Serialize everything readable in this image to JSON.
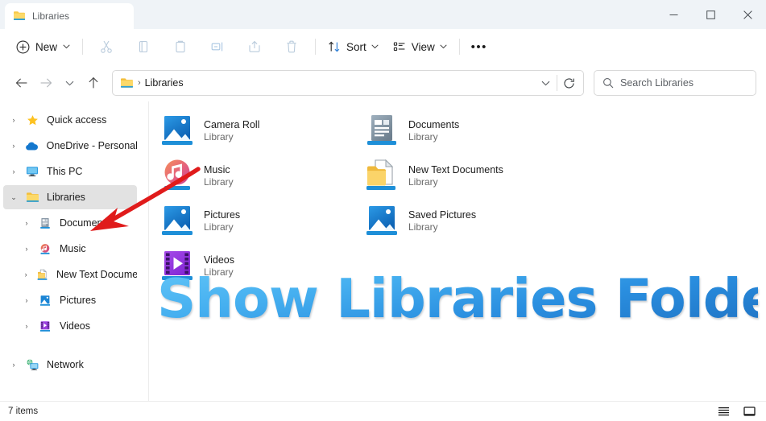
{
  "window": {
    "tab_title": "Libraries",
    "controls": {
      "minimize": "—",
      "maximize": "□",
      "close": "✕"
    }
  },
  "toolbar": {
    "new_label": "New",
    "sort_label": "Sort",
    "view_label": "View",
    "overflow_label": "•••",
    "chevron": "⌄",
    "icons": [
      {
        "name": "cut-icon",
        "title": "Cut"
      },
      {
        "name": "copy-icon",
        "title": "Copy"
      },
      {
        "name": "paste-icon",
        "title": "Paste"
      },
      {
        "name": "rename-icon",
        "title": "Rename"
      },
      {
        "name": "share-icon",
        "title": "Share"
      },
      {
        "name": "delete-icon",
        "title": "Delete"
      }
    ]
  },
  "address": {
    "back": "←",
    "forward": "→",
    "recent_chevron": "⌄",
    "up": "↑",
    "path_text": "Libraries",
    "path_separator": "›",
    "dropdown_chevron": "⌄",
    "refresh": "⟳"
  },
  "search": {
    "placeholder": "Search Libraries",
    "icon": "search-icon"
  },
  "sidebar": {
    "items": [
      {
        "label": "Quick access",
        "icon": "star-icon",
        "twisty": "›",
        "level": 0,
        "selected": false
      },
      {
        "label": "OneDrive - Personal",
        "icon": "cloud-icon",
        "twisty": "›",
        "level": 0,
        "selected": false
      },
      {
        "label": "This PC",
        "icon": "monitor-icon",
        "twisty": "›",
        "level": 0,
        "selected": false
      },
      {
        "label": "Libraries",
        "icon": "folder-icon",
        "twisty": "⌄",
        "level": 0,
        "selected": true
      },
      {
        "label": "Documents",
        "icon": "documents-library-icon",
        "twisty": "›",
        "level": 1,
        "selected": false
      },
      {
        "label": "Music",
        "icon": "music-library-icon",
        "twisty": "›",
        "level": 1,
        "selected": false
      },
      {
        "label": "New Text Document",
        "icon": "folder-doc-icon",
        "twisty": "›",
        "level": 1,
        "selected": false
      },
      {
        "label": "Pictures",
        "icon": "pictures-library-icon",
        "twisty": "›",
        "level": 1,
        "selected": false
      },
      {
        "label": "Videos",
        "icon": "videos-library-icon",
        "twisty": "›",
        "level": 1,
        "selected": false
      },
      {
        "label": "Network",
        "icon": "network-icon",
        "twisty": "›",
        "level": 0,
        "selected": false
      }
    ]
  },
  "content": {
    "items": [
      {
        "name": "Camera Roll",
        "subtitle": "Library",
        "icon": "pictures-library-icon"
      },
      {
        "name": "Documents",
        "subtitle": "Library",
        "icon": "documents-library-icon"
      },
      {
        "name": "Music",
        "subtitle": "Library",
        "icon": "music-library-icon"
      },
      {
        "name": "New Text Documents",
        "subtitle": "Library",
        "icon": "folder-doc-icon"
      },
      {
        "name": "Pictures",
        "subtitle": "Library",
        "icon": "pictures-library-icon"
      },
      {
        "name": "Saved Pictures",
        "subtitle": "Library",
        "icon": "pictures-library-icon"
      },
      {
        "name": "Videos",
        "subtitle": "Library",
        "icon": "videos-library-icon"
      }
    ]
  },
  "overlay": {
    "text": "Show Libraries Folder",
    "gradient_top": "#5fc3f7",
    "gradient_bottom": "#1f73c4",
    "annotation_arrow_color": "#e01b1b"
  },
  "statusbar": {
    "item_count": "7 items",
    "view_list_icon": "list-view-icon",
    "view_details_icon": "details-pane-icon"
  }
}
